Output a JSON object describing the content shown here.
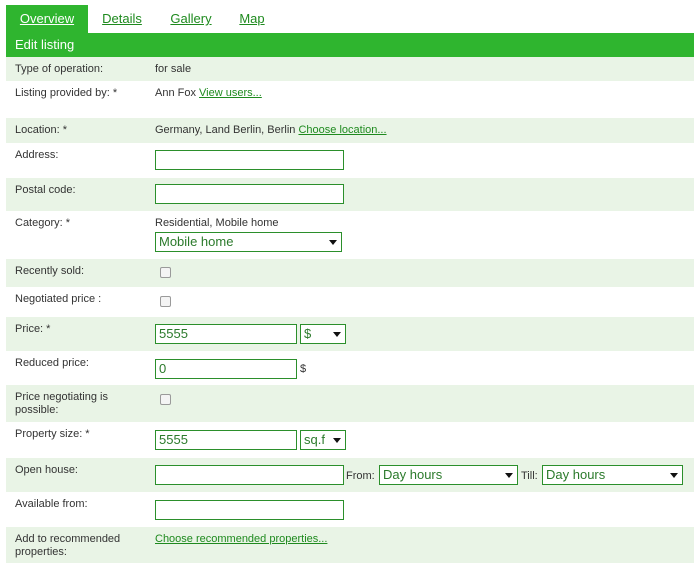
{
  "tabs": [
    {
      "label": "Overview",
      "active": true
    },
    {
      "label": "Details",
      "active": false
    },
    {
      "label": "Gallery",
      "active": false
    },
    {
      "label": "Map",
      "active": false
    }
  ],
  "header": {
    "title": "Edit listing"
  },
  "colors": {
    "accent": "#2fb52f",
    "row_shade": "#e9f4e6",
    "link": "#1e8a1e",
    "field_border": "#2b8f2b"
  },
  "form": {
    "operation": {
      "label": "Type of operation:",
      "value": "for sale"
    },
    "provider": {
      "label": "Listing provided by: *",
      "value": "Ann Fox",
      "link": "View users..."
    },
    "location": {
      "label": "Location: *",
      "value": "Germany, Land Berlin, Berlin",
      "link": "Choose location..."
    },
    "address": {
      "label": "Address:",
      "value": ""
    },
    "postal": {
      "label": "Postal code:",
      "value": ""
    },
    "category": {
      "label": "Category: *",
      "text": "Residential, Mobile home",
      "selected": "Mobile home"
    },
    "recently_sold": {
      "label": "Recently sold:",
      "checked": false
    },
    "negotiated": {
      "label": "Negotiated price :",
      "checked": false
    },
    "price": {
      "label": "Price: *",
      "value": "5555",
      "currency": "$"
    },
    "reduced": {
      "label": "Reduced price:",
      "value": "0",
      "unit": "$"
    },
    "negotiable": {
      "label": "Price negotiating is possible:",
      "checked": false
    },
    "size": {
      "label": "Property size: *",
      "value": "5555",
      "unit": "sq.f"
    },
    "open_house": {
      "label": "Open house:",
      "value": "",
      "from_label": "From:",
      "from_value": "Day hours",
      "till_label": "Till:",
      "till_value": "Day hours"
    },
    "available": {
      "label": "Available from:",
      "value": ""
    },
    "recommended": {
      "label": "Add to recommended properties:",
      "link": "Choose recommended properties..."
    }
  }
}
